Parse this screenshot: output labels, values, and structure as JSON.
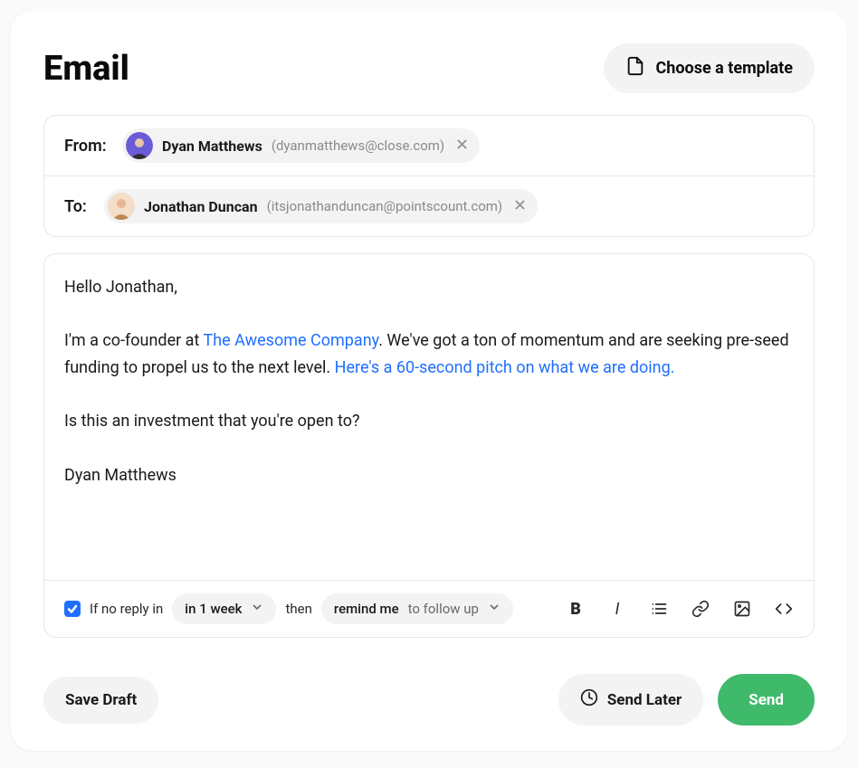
{
  "header": {
    "title": "Email",
    "template_button": "Choose a template"
  },
  "from": {
    "label": "From:",
    "name": "Dyan Matthews",
    "email": "(dyanmatthews@close.com)"
  },
  "to": {
    "label": "To:",
    "name": "Jonathan Duncan",
    "email": "(itsjonathanduncan@pointscount.com)"
  },
  "body": {
    "greeting": "Hello Jonathan,",
    "p1a": "I'm a co-founder at ",
    "link1": "The Awesome Company",
    "p1b": ". We've got a ton of momentum and are seeking pre-seed funding to propel us to the next level. ",
    "link2": "Here's a 60-second pitch on what we are doing.",
    "p2": "Is this an investment that you're open to?",
    "sign": "Dyan Matthews"
  },
  "followup": {
    "if_text": "If no reply in",
    "time_value": "in 1 week",
    "then_text": "then",
    "action_value": "remind me",
    "action_hint": "to follow up"
  },
  "actions": {
    "save_draft": "Save Draft",
    "send_later": "Send Later",
    "send": "Send"
  }
}
